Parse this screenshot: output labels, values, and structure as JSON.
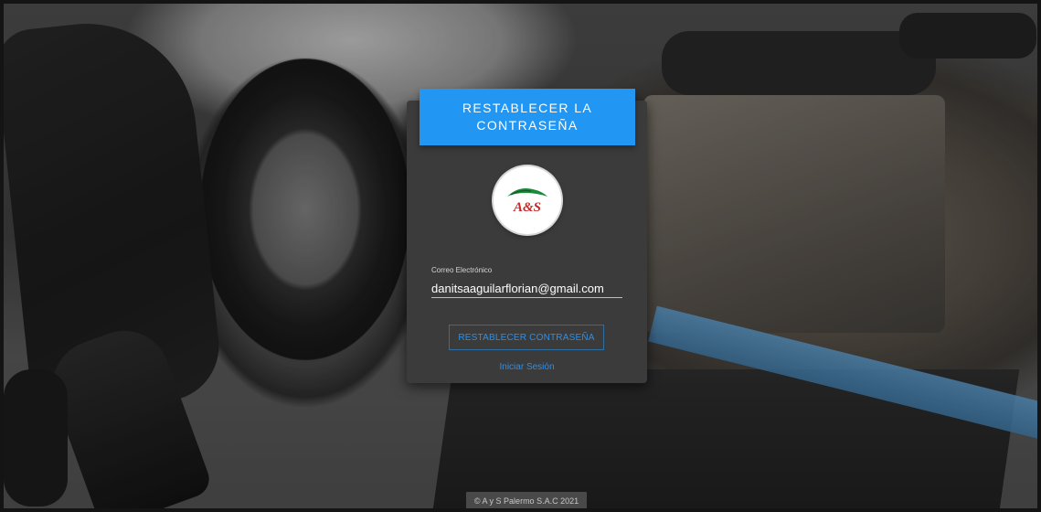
{
  "card": {
    "title_line1": "RESTABLECER LA",
    "title_line2": "CONTRASEÑA",
    "logo_text": "A&S",
    "email_label": "Correo Electrónico",
    "email_value": "danitsaaguilarflorian@gmail.com",
    "reset_button_label": "RESTABLECER CONTRASEÑA",
    "login_link_label": "Iniciar Sesión"
  },
  "footer": {
    "text": "© A y S Palermo S.A.C 2021"
  },
  "colors": {
    "accent": "#2196f3",
    "card_bg": "#3b3b3b",
    "link": "#2e8fe6",
    "logo_red": "#c62828",
    "logo_green": "#1b8a3a"
  },
  "icons": {
    "logo": "car-logo-icon"
  }
}
